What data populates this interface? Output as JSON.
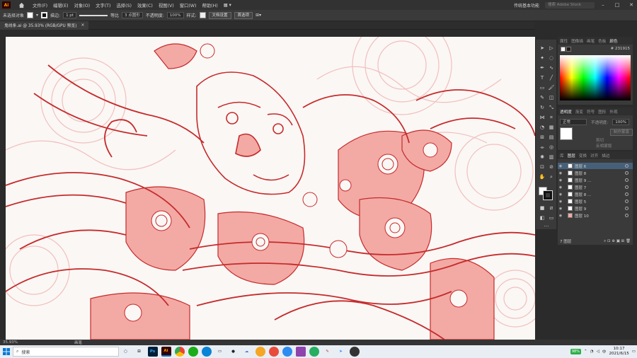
{
  "menubar": {
    "items": [
      "文件(F)",
      "编辑(E)",
      "对象(O)",
      "文字(T)",
      "选择(S)",
      "效果(C)",
      "视图(V)",
      "窗口(W)",
      "帮助(H)"
    ],
    "workspace": "传统基本功能",
    "stock_search_placeholder": "搜索 Adobe Stock"
  },
  "controlbar": {
    "no_selection": "未选择对象",
    "stroke_label": "描边:",
    "stroke_width": "1 pt",
    "stroke_style": "等比",
    "brush": "3 点圆形",
    "opacity_label": "不透明度:",
    "opacity_value": "100%",
    "style_label": "样式:",
    "doc_setup": "文档设置",
    "preferences": "首选项"
  },
  "document": {
    "tab_title": "鬼线条.ai @ 35.93% (RGB/GPU 预览)",
    "close": "×"
  },
  "color_panel": {
    "tabs": [
      "属性",
      "图像描",
      "画笔",
      "色板",
      "颜色"
    ],
    "hex": "231915"
  },
  "transparency_panel": {
    "tabs": [
      "透明度",
      "渐变",
      "符号",
      "图形",
      "外观"
    ],
    "mode": "正常",
    "opacity_label": "不透明度:",
    "opacity_value": "100%",
    "make_mask": "制作蒙版",
    "clip": "剪切",
    "invert": "反相蒙版"
  },
  "layers_panel": {
    "tabs": [
      "库",
      "图层",
      "变换",
      "对齐",
      "描边"
    ],
    "layers": [
      "图层 6",
      "图层 8",
      "图层 9 ...",
      "图层 7",
      "图层 8 ...",
      "图层 5",
      "图层 9",
      "图层 10"
    ],
    "footer": "7 图层"
  },
  "status": {
    "zoom": "35.93%",
    "tool": "画笔"
  },
  "taskbar": {
    "search_placeholder": "搜索",
    "battery": "98%",
    "time": "10:17",
    "date": "2021/6/15",
    "apps": [
      {
        "name": "photoshop",
        "label": "Ps",
        "bg": "#001e36",
        "fg": "#31a8ff"
      },
      {
        "name": "illustrator",
        "label": "Ai",
        "bg": "#330000",
        "fg": "#ff9a00"
      }
    ]
  },
  "colors": {
    "line_art": "#c52b2b",
    "fill_art": "#f0a3a0",
    "ghost_art": "#f0c0bc",
    "selected_layer": "#46607a"
  }
}
